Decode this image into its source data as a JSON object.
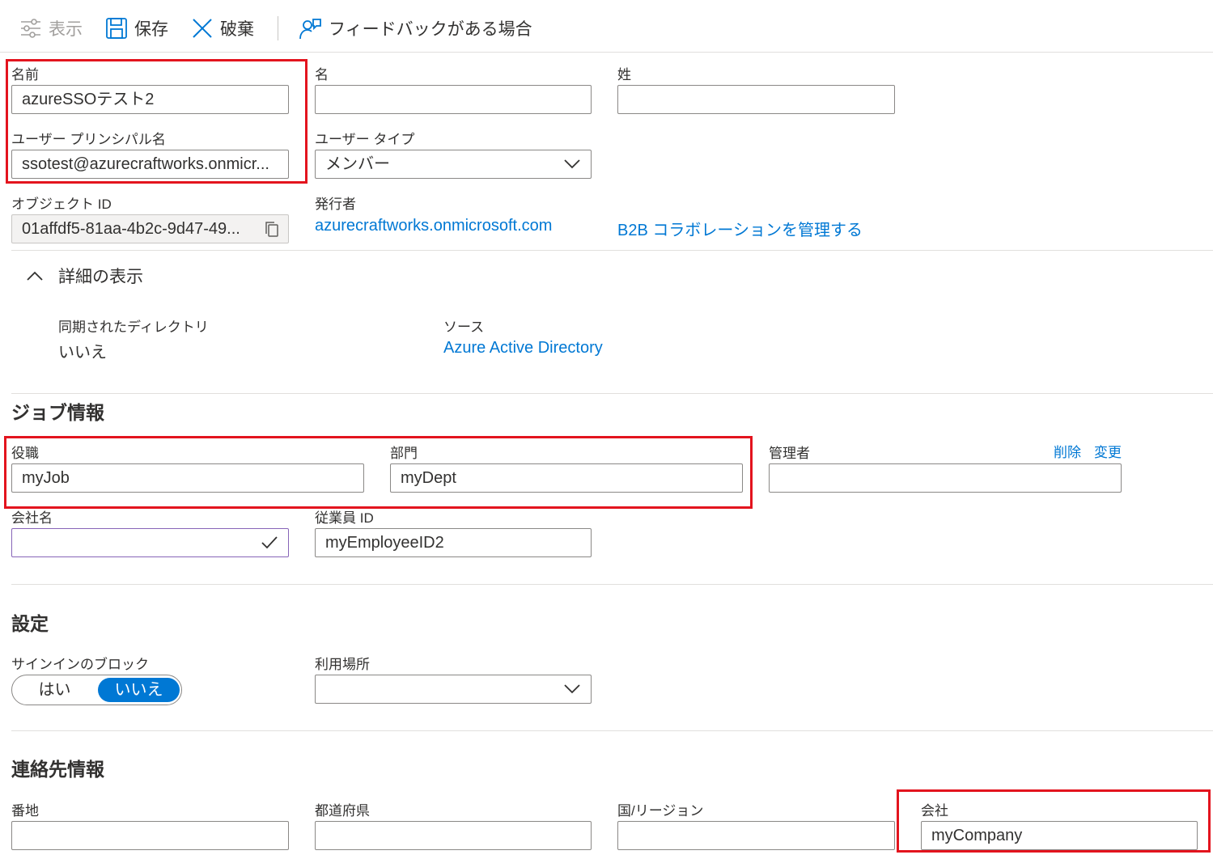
{
  "toolbar": {
    "view_label": "表示",
    "save_label": "保存",
    "discard_label": "破棄",
    "feedback_label": "フィードバックがある場合"
  },
  "identity": {
    "name_label": "名前",
    "name_value": "azureSSOテスト2",
    "given_name_label": "名",
    "given_name_value": "",
    "surname_label": "姓",
    "surname_value": "",
    "upn_label": "ユーザー プリンシパル名",
    "upn_value": "ssotest@azurecraftworks.onmicr...",
    "user_type_label": "ユーザー タイプ",
    "user_type_value": "メンバー",
    "object_id_label": "オブジェクト ID",
    "object_id_value": "01affdf5-81aa-4b2c-9d47-49...",
    "issuer_label": "発行者",
    "issuer_value": "azurecraftworks.onmicrosoft.com",
    "b2b_link": "B2B コラボレーションを管理する"
  },
  "details": {
    "toggle_label": "詳細の表示",
    "synced_label": "同期されたディレクトリ",
    "synced_value": "いいえ",
    "source_label": "ソース",
    "source_value": "Azure Active Directory"
  },
  "job": {
    "section_title": "ジョブ情報",
    "job_title_label": "役職",
    "job_title_value": "myJob",
    "department_label": "部門",
    "department_value": "myDept",
    "manager_label": "管理者",
    "manager_value": "",
    "delete_link": "削除",
    "change_link": "変更",
    "company_label": "会社名",
    "company_value": "",
    "employee_id_label": "従業員 ID",
    "employee_id_value": "myEmployeeID2"
  },
  "settings": {
    "section_title": "設定",
    "block_signin_label": "サインインのブロック",
    "toggle_yes": "はい",
    "toggle_no": "いいえ",
    "toggle_selected": "いいえ",
    "usage_location_label": "利用場所",
    "usage_location_value": ""
  },
  "contact": {
    "section_title": "連絡先情報",
    "street_label": "番地",
    "street_value": "",
    "state_label": "都道府県",
    "state_value": "",
    "country_label": "国/リージョン",
    "country_value": "",
    "company_label": "会社",
    "company_value": "myCompany"
  },
  "colors": {
    "accent": "#0078d4",
    "highlight_box": "#e3141e",
    "focus_border": "#8764b8"
  }
}
